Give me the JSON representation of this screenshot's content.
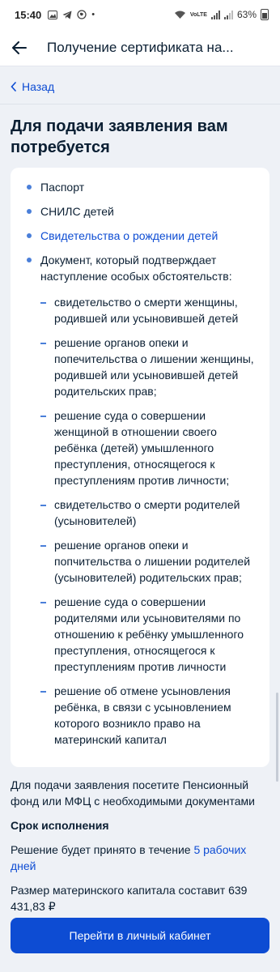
{
  "status_bar": {
    "time": "15:40",
    "network": "VoLTE",
    "battery": "63%"
  },
  "header": {
    "title": "Получение сертификата на..."
  },
  "back_link": {
    "label": "Назад"
  },
  "heading": "Для подачи заявления вам потребуется",
  "documents": [
    {
      "text": "Паспорт"
    },
    {
      "text": "СНИЛС детей"
    },
    {
      "text": "Свидетельства о рождении детей"
    },
    {
      "text": "Документ, который подтверждает наступление особых обстоятельств:"
    }
  ],
  "circumstances": [
    "свидетельство о смерти женщины, родившей или усыновившей детей",
    "решение органов опеки и попечительства о лишении женщины, родившей или усыновившей детей родительских прав;",
    "решение суда о совершении женщиной в отношении своего ребёнка (детей) умышленного преступления, относящегося к преступлениям против личности;",
    "свидетельство о смерти родителей (усыновителей)",
    "решение органов опеки и попчительства о лишении родителей (усыновителей) родительских прав;",
    "решение суда о совершении родителями или усыновителями по отношению к ребёнку умышленного преступления, относящегося к преступлениям против личности",
    "решение об отмене усыновления ребёнка, в связи с усыновлением которого возникло право на материнский капитал"
  ],
  "info": {
    "visit_text": "Для подачи заявления посетите Пенсионный фонд или МФЦ с необходимыми документами",
    "deadline_title": "Срок исполнения",
    "decision_prefix": "Решение будет принято в течение",
    "decision_link": "5 рабочих дней",
    "capital_text": "Размер материнского капитала составит 639 431,83 ₽"
  },
  "primary_button": {
    "label": "Перейти в личный кабинет"
  },
  "colors": {
    "accent": "#0d4cd3",
    "bullet": "#4a7fd9",
    "background": "#eef1f6"
  }
}
